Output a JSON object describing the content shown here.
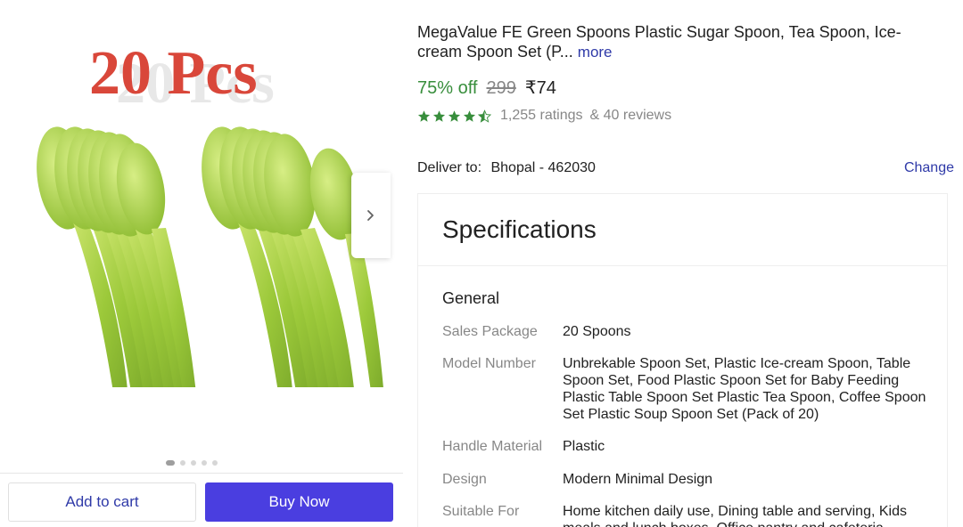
{
  "gallery": {
    "image_caption": "20 Pcs",
    "image_alt": "green plastic spoons",
    "dots_total": 5,
    "dots_active_index": 0
  },
  "actions": {
    "add_to_cart": "Add to cart",
    "buy_now": "Buy Now"
  },
  "product": {
    "title": "MegaValue FE Green Spoons Plastic Sugar Spoon, Tea Spoon, Ice-cream Spoon Set (P...",
    "more_link": "more",
    "discount": "75% off",
    "mrp": "299",
    "price": "₹74",
    "rating_value": 4.5,
    "ratings_count": "1,255 ratings",
    "reviews_count": "& 40 reviews"
  },
  "delivery": {
    "label": "Deliver to:",
    "location": "Bhopal - 462030",
    "change": "Change"
  },
  "specs": {
    "heading": "Specifications",
    "group": "General",
    "rows": [
      {
        "key": "Sales Package",
        "value": "20 Spoons"
      },
      {
        "key": "Model Number",
        "value": "Unbrekable Spoon Set, Plastic Ice-cream Spoon, Table Spoon Set, Food Plastic Spoon Set for Baby Feeding Plastic Table Spoon Set Plastic Tea Spoon, Coffee Spoon Set Plastic Soup Spoon Set (Pack of 20)"
      },
      {
        "key": "Handle Material",
        "value": "Plastic"
      },
      {
        "key": "Design",
        "value": "Modern Minimal Design"
      },
      {
        "key": "Suitable For",
        "value": "Home kitchen daily use, Dining table and serving, Kids meals and lunch boxes, Office pantry and cafeteria"
      }
    ]
  },
  "colors": {
    "accent": "#2f3aa8",
    "buy_button": "#4a3ee0",
    "discount": "#388e3c",
    "star": "#388e3c"
  }
}
